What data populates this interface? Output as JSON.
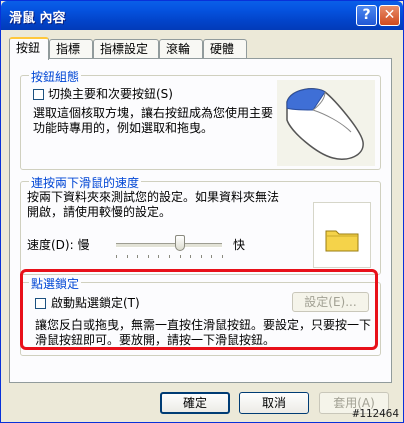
{
  "window": {
    "title": "滑鼠 內容",
    "help_button": "?",
    "close_button": "✕"
  },
  "tabs": [
    "按鈕",
    "指標",
    "指標設定",
    "滾輪",
    "硬體"
  ],
  "button_config": {
    "title": "按鈕組態",
    "swap_label": "切換主要和次要按鈕(S)",
    "description": "選取這個核取方塊，讓右按鈕成為您使用主要功能時專用的，例如選取和拖曳。"
  },
  "double_click": {
    "title": "連按兩下滑鼠的速度",
    "description": "按兩下資料夾來測試您的設定。如果資料夾無法開啟，請使用較慢的設定。",
    "speed_label": "速度(D): 慢",
    "fast_label": "快",
    "speed_value_fraction": 0.6
  },
  "click_lock": {
    "title": "點選鎖定",
    "enable_label": "啟動點選鎖定(T)",
    "settings_button": "設定(E)...",
    "description": "讓您反白或拖曳，無需一直按住滑鼠按鈕。要設定，只要按一下滑鼠按鈕即可。要放開，請按一下滑鼠按鈕。"
  },
  "footer": {
    "ok": "確定",
    "cancel": "取消",
    "apply": "套用(A)"
  },
  "watermark": "#112464",
  "colors": {
    "group_title": "#0046d5",
    "highlight": "#e8101a",
    "titlebar": "#0553e0"
  }
}
